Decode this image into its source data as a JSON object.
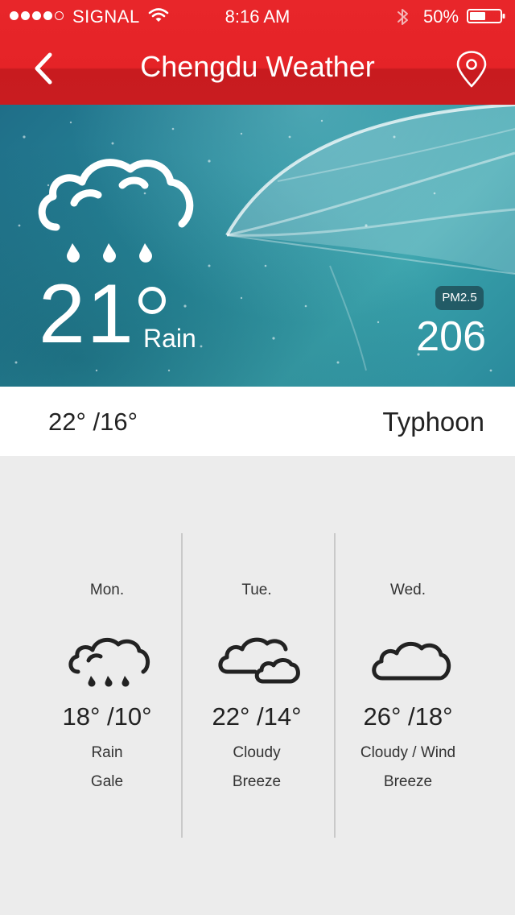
{
  "status_bar": {
    "carrier": "SIGNAL",
    "time": "8:16 AM",
    "battery": "50%",
    "icons": [
      "signal-dots-icon",
      "wifi-icon",
      "bluetooth-icon",
      "battery-icon"
    ]
  },
  "nav": {
    "title": "Chengdu Weather",
    "back_icon": "chevron-left-icon",
    "location_icon": "location-pin-icon"
  },
  "current": {
    "temperature": "21",
    "condition": "Rain",
    "icon": "rain-cloud-icon",
    "pm_label": "PM2.5",
    "pm_value": "206"
  },
  "today": {
    "range": "22° /16°",
    "alert": "Typhoon"
  },
  "forecast": [
    {
      "day": "Mon.",
      "range": "18° /10°",
      "condition": "Rain",
      "wind": "Gale",
      "icon": "rain-cloud-icon"
    },
    {
      "day": "Tue.",
      "range": "22° /14°",
      "condition": "Cloudy",
      "wind": "Breeze",
      "icon": "double-cloud-icon"
    },
    {
      "day": "Wed.",
      "range": "26° /18°",
      "condition": "Cloudy / Wind",
      "wind": "Breeze",
      "icon": "cloud-icon"
    }
  ],
  "colors": {
    "header": "#e52327",
    "header_dark": "#c91c20",
    "hero_teal": "#2a8f9f",
    "background": "#ececec"
  }
}
